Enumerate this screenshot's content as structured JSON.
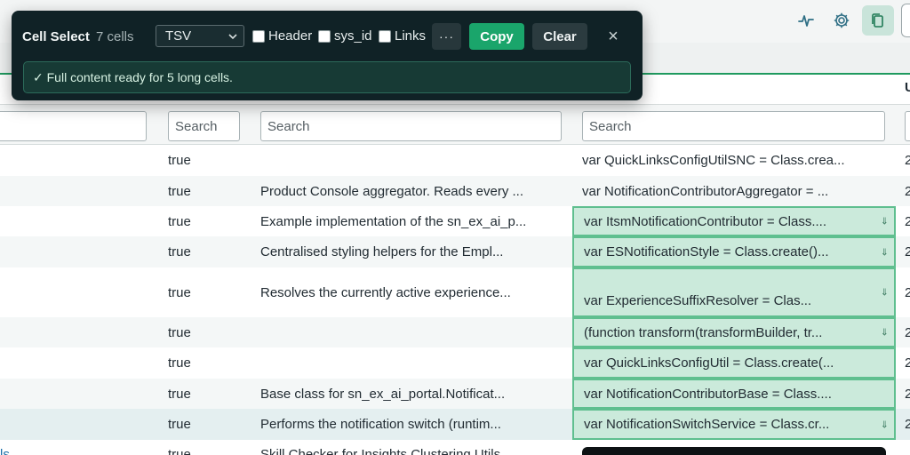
{
  "toolbar": {
    "icons": [
      "activity-icon",
      "gear-icon",
      "copy-icon"
    ]
  },
  "header": {
    "right_column_label": "U"
  },
  "popup": {
    "title": "Cell Select",
    "count": "7 cells",
    "format": {
      "selected": "TSV"
    },
    "options": [
      {
        "label": "Header",
        "checked": false
      },
      {
        "label": "sys_id",
        "checked": false
      },
      {
        "label": "Links",
        "checked": false
      }
    ],
    "more_label": "···",
    "copy_label": "Copy",
    "clear_label": "Clear",
    "close_label": "×",
    "status": "✓ Full content ready for 5 long cells."
  },
  "search": {
    "placeholders": [
      "",
      "Search",
      "Search",
      "Search"
    ]
  },
  "rows": [
    {
      "active": "true",
      "description": "",
      "script": "var QuickLinksConfigUtilSNC = Class.crea...",
      "selected": false,
      "download": false,
      "right": "2"
    },
    {
      "active": "true",
      "description": "Product Console aggregator. Reads every ...",
      "script": "var NotificationContributorAggregator = ...",
      "selected": false,
      "download": false,
      "right": "2"
    },
    {
      "active": "true",
      "description": "Example implementation of the sn_ex_ai_p...",
      "script": "var ItsmNotificationContributor = Class....",
      "selected": true,
      "download": true,
      "right": "2"
    },
    {
      "active": "true",
      "description": "Centralised styling helpers for the Empl...",
      "script": "var ESNotificationStyle = Class.create()...",
      "selected": true,
      "download": true,
      "right": "2"
    },
    {
      "active": "true",
      "description": "Resolves the currently active experience...",
      "script": "var ExperienceSuffixResolver = Clas...",
      "selected": true,
      "download": true,
      "right": "2"
    },
    {
      "active": "true",
      "description": "",
      "script": "(function transform(transformBuilder, tr...",
      "selected": true,
      "download": true,
      "right": "2"
    },
    {
      "active": "true",
      "description": "",
      "script": "var QuickLinksConfigUtil = Class.create(...",
      "selected": true,
      "download": false,
      "right": "2"
    },
    {
      "active": "true",
      "description": "Base class for sn_ex_ai_portal.Notificat...",
      "script": "var NotificationContributorBase = Class....",
      "selected": true,
      "download": false,
      "right": "2"
    },
    {
      "active": "true",
      "description": "Performs the notification switch (runtim...",
      "script": "var NotificationSwitchService = Class.cr...",
      "selected": true,
      "download": true,
      "right": "2"
    },
    {
      "active": "true",
      "description": "Skill Checker for Insights Clustering Utils",
      "script": "",
      "selected": false,
      "download": false,
      "right": "",
      "left_link": "ls"
    }
  ],
  "download_glyph": "⇓"
}
